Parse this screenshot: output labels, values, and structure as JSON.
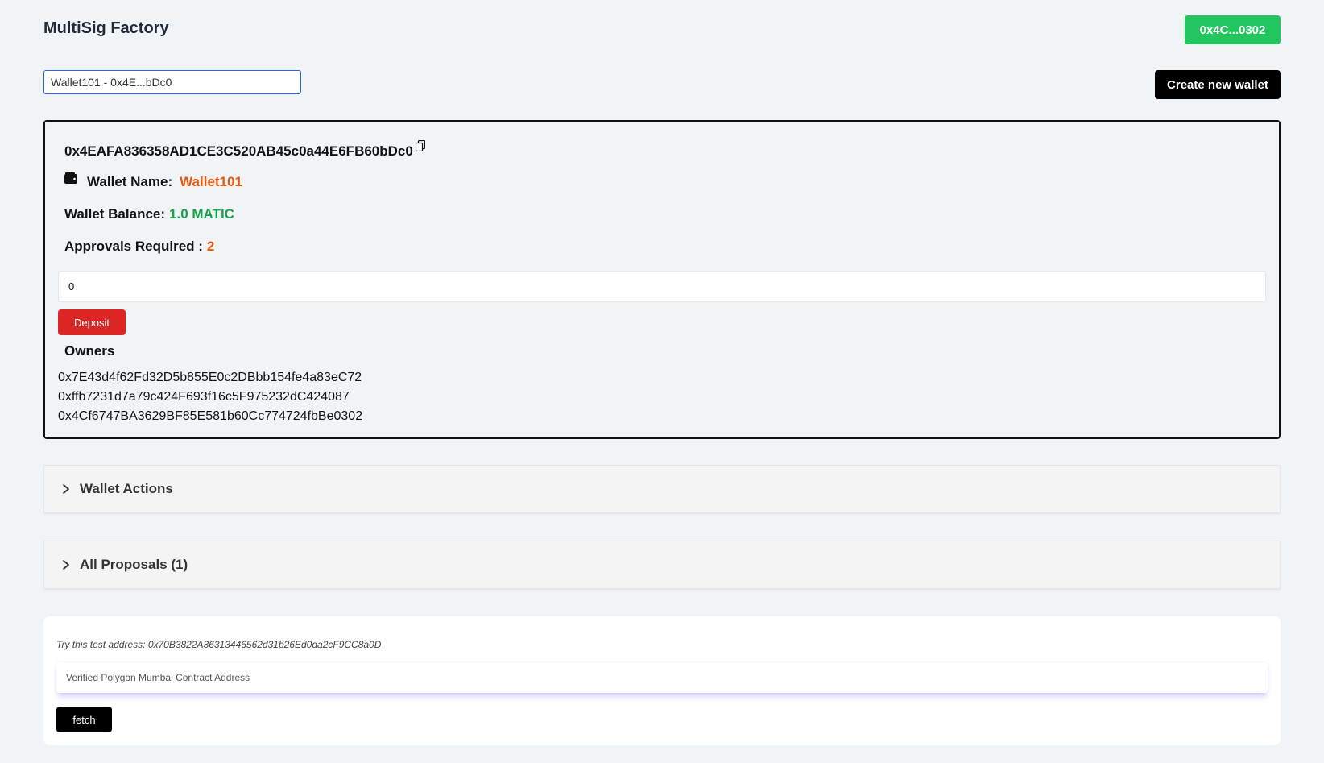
{
  "header": {
    "title": "MultiSig Factory",
    "account_label": "0x4C...0302",
    "account_color": "#22c55e"
  },
  "wallet_selector": {
    "selected": "Wallet101 - 0x4E...bDc0"
  },
  "toolbar": {
    "create_label": "Create new wallet"
  },
  "wallet": {
    "address": "0x4EAFA836358AD1CE3C520AB45c0a44E6FB60bDc0",
    "name_label": "Wallet Name:",
    "name_value": "Wallet101",
    "balance_label": "Wallet Balance:",
    "balance_value": "1.0 MATIC",
    "approvals_label": "Approvals Required :",
    "approvals_value": "2",
    "deposit_amount": "0",
    "deposit_label": "Deposit",
    "owners_heading": "Owners",
    "owners": [
      "0x7E43d4f62Fd32D5b855E0c2DBbb154fe4a83eC72",
      "0xffb7231d7a79c424F693f16c5F975232dC424087",
      "0x4Cf6747BA3629BF85E581b60Cc774724fbBe0302"
    ],
    "icons": {
      "copy": "copy-icon",
      "wallet": "wallet-icon"
    }
  },
  "sections": {
    "wallet_actions": "Wallet Actions",
    "all_proposals": "All Proposals (1)"
  },
  "fetch": {
    "hint": "Try this test address: 0x70B3822A36313446562d31b26Ed0da2cF9CC8a0D",
    "placeholder": "Verified Polygon Mumbai Contract Address",
    "button_label": "fetch"
  },
  "colors": {
    "accent_orange": "#ea580c",
    "accent_green": "#16a34a",
    "deposit_red": "#dc2626"
  }
}
